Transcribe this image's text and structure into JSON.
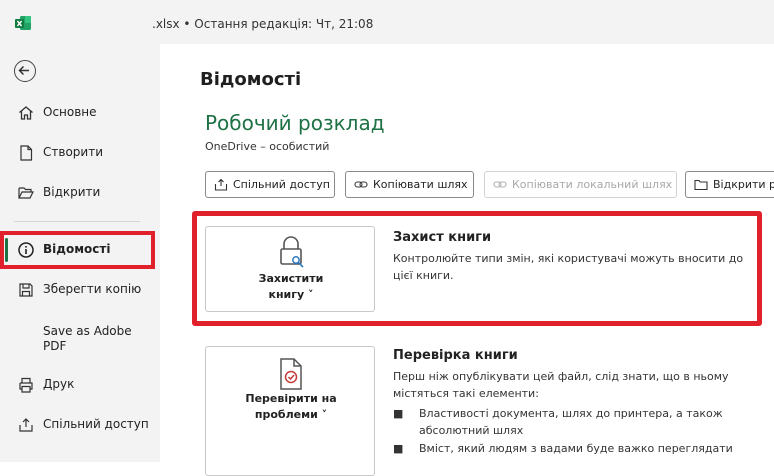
{
  "window": {
    "title": ".xlsx  •  Остання редакція: Чт, 21:08"
  },
  "sidebar": {
    "items": [
      {
        "label": "Основне",
        "icon": "home-icon"
      },
      {
        "label": "Створити",
        "icon": "new-document-icon"
      },
      {
        "label": "Відкрити",
        "icon": "folder-open-icon"
      },
      {
        "label": "Відомості",
        "icon": "info-icon",
        "active": true
      },
      {
        "label": "Зберегти копію",
        "icon": "save-icon"
      },
      {
        "label": "Save as Adobe PDF",
        "icon": "none"
      },
      {
        "label": "Друк",
        "icon": "printer-icon"
      },
      {
        "label": "Спільний доступ",
        "icon": "share-icon"
      }
    ]
  },
  "main": {
    "title": "Відомості",
    "document_name": "Робочий розклад",
    "location": "OneDrive – особистий",
    "toolbar": [
      {
        "label": "Спільний доступ",
        "icon": "share-icon",
        "enabled": true
      },
      {
        "label": "Копіювати шлях",
        "icon": "link-icon",
        "enabled": true
      },
      {
        "label": "Копіювати локальний шлях",
        "icon": "link-icon",
        "enabled": false
      },
      {
        "label": "Відкрити р",
        "icon": "folder-icon",
        "enabled": true
      }
    ],
    "protect": {
      "button_label_1": "Захистити",
      "button_label_2": "книгу ˅",
      "title": "Захист книги",
      "description": "Контролюйте типи змін, які користувачі можуть вносити до цієї книги."
    },
    "inspect": {
      "button_label_1": "Перевірити на",
      "button_label_2": "проблеми ˅",
      "title": "Перевірка книги",
      "description": "Перш ніж опублікувати цей файл, слід знати, що в ньому містяться такі елементи:",
      "bullets": [
        "Властивості документа, шлях до принтера, а також абсолютний шлях",
        "Вміст, який людям з вадами буде важко переглядати"
      ]
    }
  },
  "colors": {
    "accent_green": "#1e7145",
    "highlight_red": "#e0202a"
  }
}
